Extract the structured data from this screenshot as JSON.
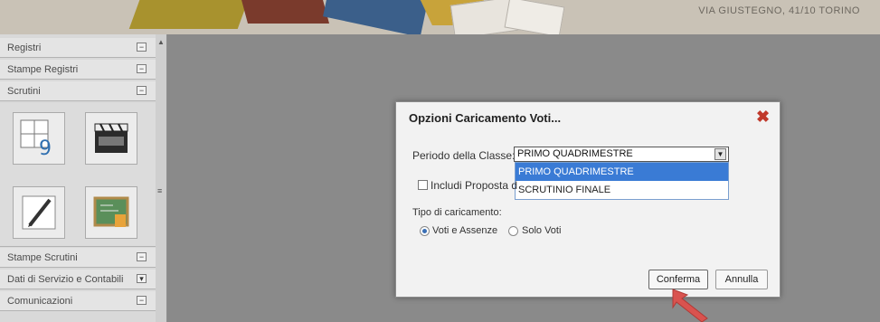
{
  "banner": {
    "text": "VIA GIUSTEGNO, 41/10    TORINO"
  },
  "sidebar": {
    "sections": [
      {
        "label": "Registri",
        "toggle": "−"
      },
      {
        "label": "Stampe Registri",
        "toggle": "−"
      },
      {
        "label": "Scrutini",
        "toggle": "−"
      },
      {
        "label": "Stampe Scrutini",
        "toggle": "−"
      },
      {
        "label": "Dati di Servizio e Contabili",
        "toggle": "▾"
      },
      {
        "label": "Comunicazioni",
        "toggle": "−"
      }
    ],
    "tiles": [
      {
        "icon": "grade-grid-icon",
        "text": "9"
      },
      {
        "icon": "clapperboard-icon",
        "text": ""
      },
      {
        "icon": "pencil-icon",
        "text": ""
      },
      {
        "icon": "chalkboard-icon",
        "text": ""
      }
    ]
  },
  "dialog": {
    "title": "Opzioni Caricamento Voti...",
    "close_icon": "close-icon",
    "periodo_label": "Periodo della Classe:",
    "periodo_value": "PRIMO QUADRIMESTRE",
    "periodo_options": [
      "PRIMO QUADRIMESTRE",
      "SCRUTINIO FINALE"
    ],
    "includi_label": "Includi Proposta d",
    "tipo_label": "Tipo di caricamento:",
    "radio_voti_assenze": "Voti e Assenze",
    "radio_solo_voti": "Solo Voti",
    "confirm_label": "Conferma",
    "cancel_label": "Annulla"
  },
  "colors": {
    "accent": "#3a7bd5",
    "close": "#c0392b",
    "pointer_arrow": "#d9534f"
  }
}
